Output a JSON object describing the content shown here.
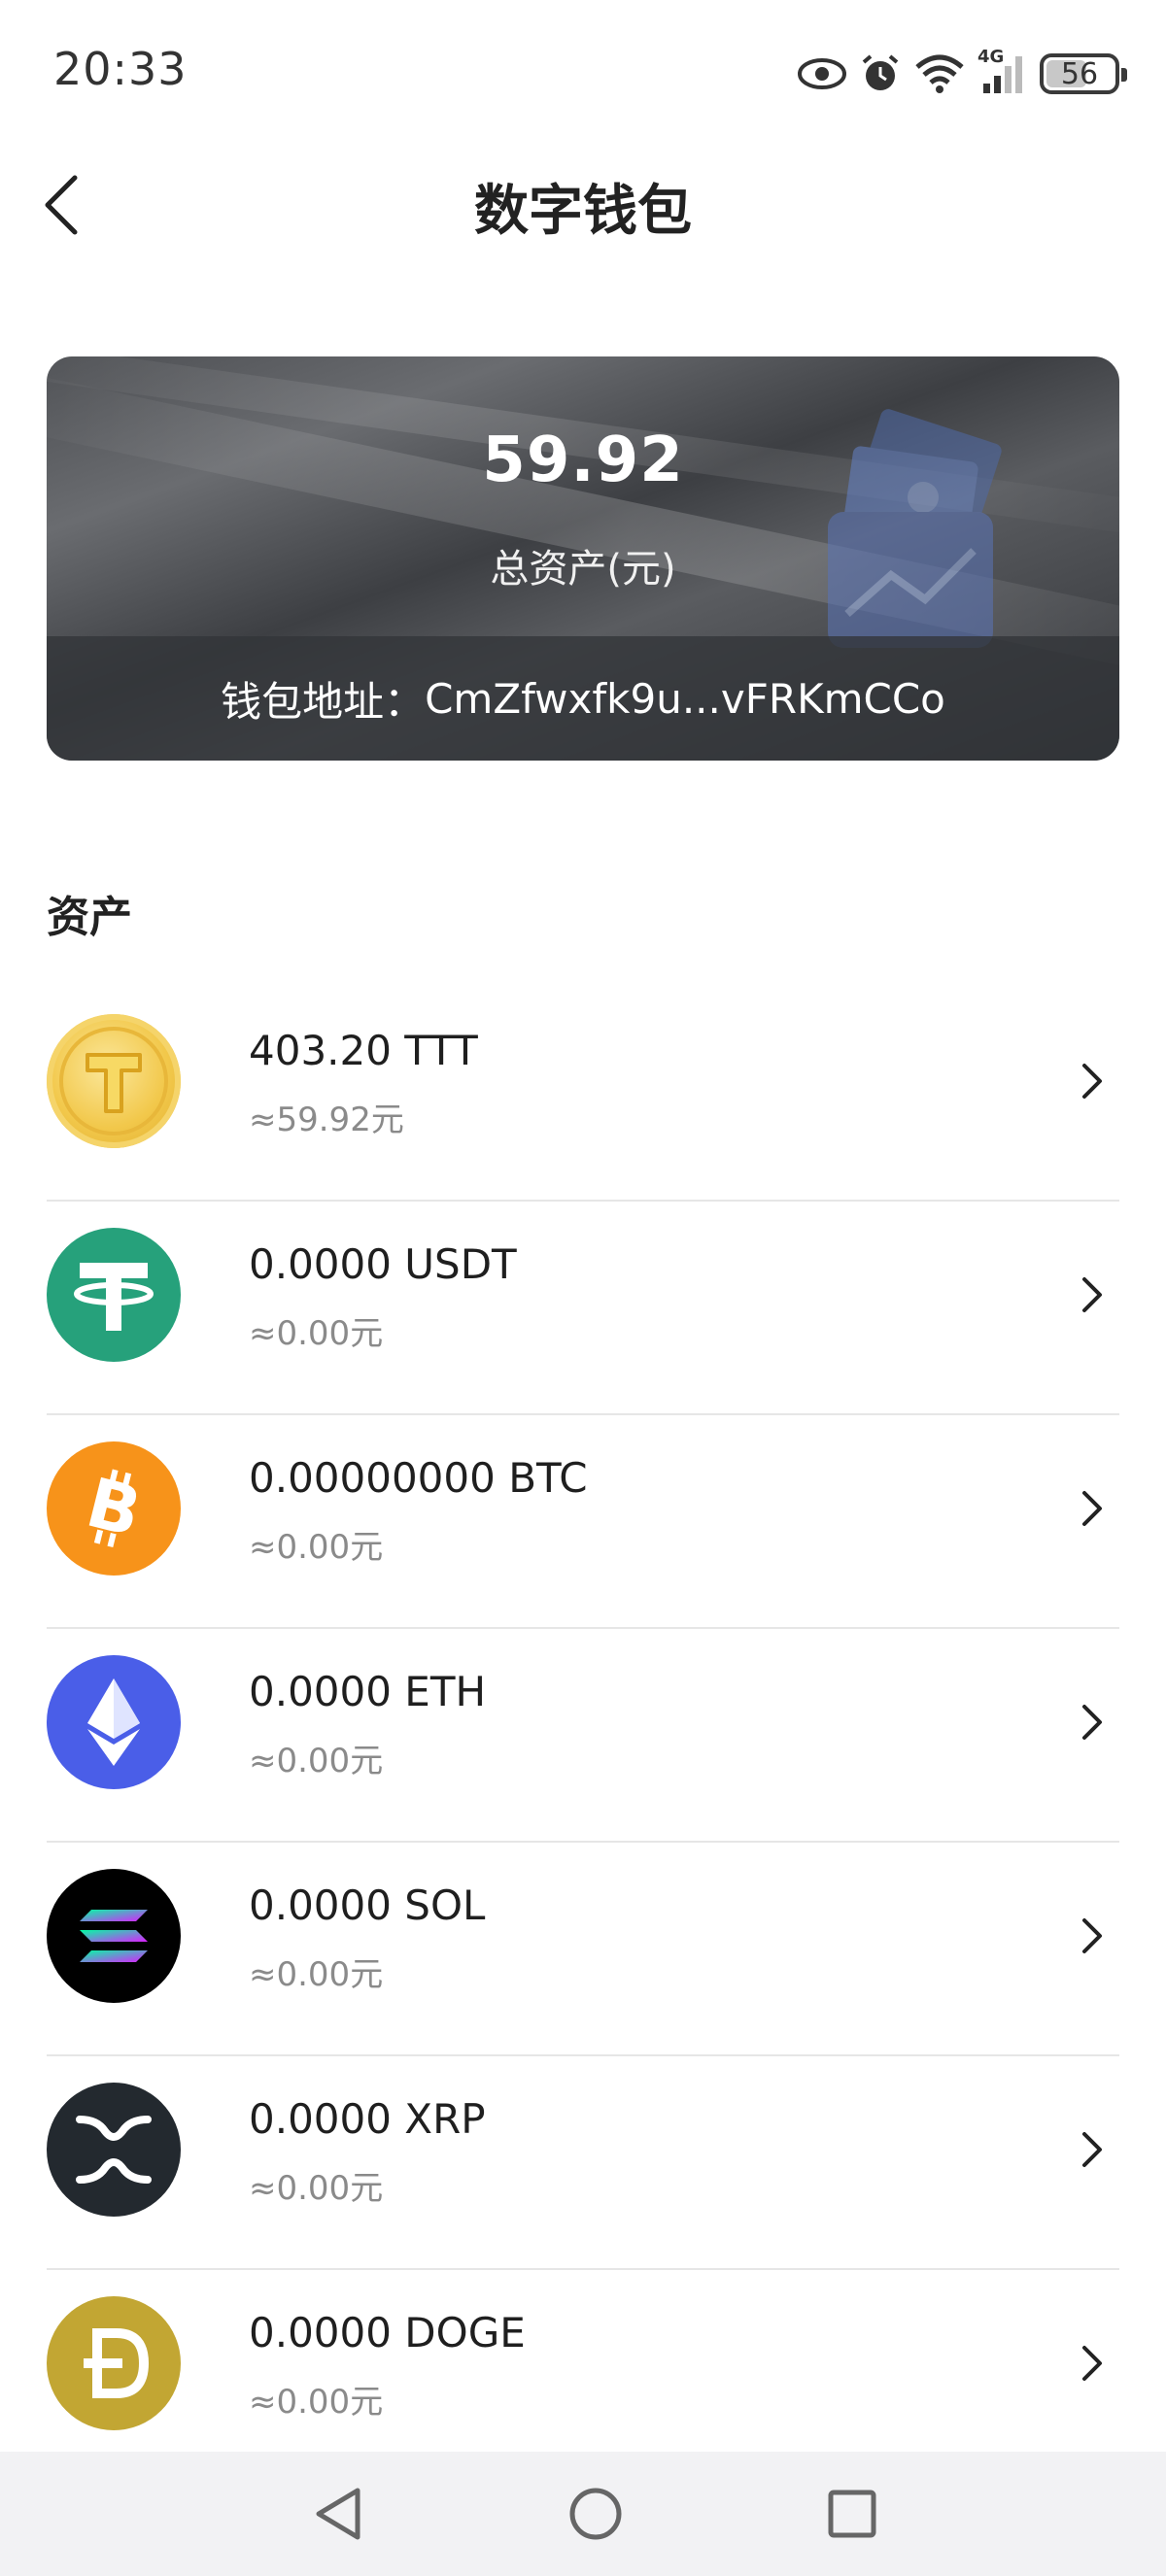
{
  "status_bar": {
    "time": "20:33",
    "battery": "56",
    "icons": [
      "eye-icon",
      "alarm-icon",
      "wifi-icon",
      "signal-4g-icon",
      "battery-icon"
    ],
    "network_label": "4G"
  },
  "header": {
    "title": "数字钱包",
    "back_icon": "chevron-left-icon"
  },
  "wallet_card": {
    "total": "59.92",
    "total_label": "总资产(元)",
    "address_label": "钱包地址：",
    "address_value": "CmZfwxfk9u...vFRKmCCo"
  },
  "assets_section": {
    "title": "资产",
    "items": [
      {
        "symbol": "TTT",
        "amount": "403.20 TTT",
        "value": "≈59.92元",
        "icon": "ttt-coin-icon",
        "color": "#f2c84b"
      },
      {
        "symbol": "USDT",
        "amount": "0.0000 USDT",
        "value": "≈0.00元",
        "icon": "tether-icon",
        "color": "#26a17b"
      },
      {
        "symbol": "BTC",
        "amount": "0.00000000 BTC",
        "value": "≈0.00元",
        "icon": "bitcoin-icon",
        "color": "#f7931a"
      },
      {
        "symbol": "ETH",
        "amount": "0.0000 ETH",
        "value": "≈0.00元",
        "icon": "ethereum-icon",
        "color": "#4a5ee8"
      },
      {
        "symbol": "SOL",
        "amount": "0.0000 SOL",
        "value": "≈0.00元",
        "icon": "solana-icon",
        "color": "#000000"
      },
      {
        "symbol": "XRP",
        "amount": "0.0000 XRP",
        "value": "≈0.00元",
        "icon": "xrp-icon",
        "color": "#23292f"
      },
      {
        "symbol": "DOGE",
        "amount": "0.0000 DOGE",
        "value": "≈0.00元",
        "icon": "dogecoin-icon",
        "color": "#c2a633"
      }
    ]
  },
  "nav_bar": {
    "icons": [
      "nav-back-icon",
      "nav-home-icon",
      "nav-recents-icon"
    ]
  }
}
